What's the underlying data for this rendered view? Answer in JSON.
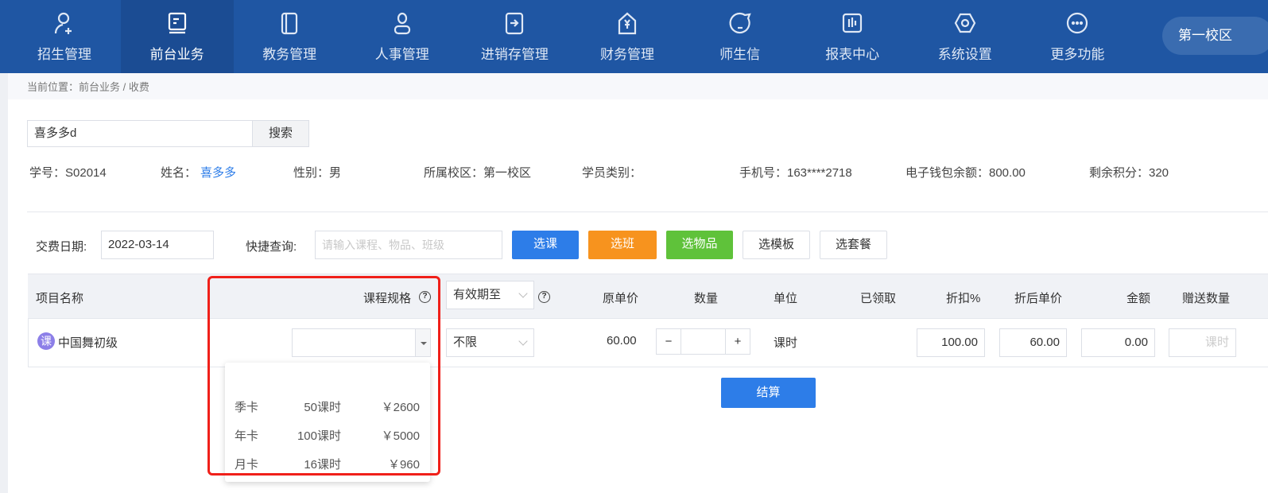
{
  "nav": {
    "items": [
      {
        "label": "招生管理",
        "icon": "user-add-icon"
      },
      {
        "label": "前台业务",
        "icon": "desk-icon",
        "active": true
      },
      {
        "label": "教务管理",
        "icon": "book-icon"
      },
      {
        "label": "人事管理",
        "icon": "person-icon"
      },
      {
        "label": "进销存管理",
        "icon": "inventory-arrow-icon"
      },
      {
        "label": "财务管理",
        "icon": "finance-yen-icon"
      },
      {
        "label": "师生信",
        "icon": "chat-icon"
      },
      {
        "label": "报表中心",
        "icon": "report-chart-icon"
      },
      {
        "label": "系统设置",
        "icon": "settings-hex-icon"
      },
      {
        "label": "更多功能",
        "icon": "more-dots-icon"
      }
    ],
    "campus": "第一校区"
  },
  "breadcrumb": "当前位置：前台业务 / 收费",
  "search": {
    "value": "喜多多d",
    "button": "搜索"
  },
  "student": {
    "id": "学号：S02014",
    "name_label": "姓名：",
    "name": "喜多多",
    "gender": "性别：男",
    "campus": "所属校区：第一校区",
    "type": "学员类别：",
    "phone": "手机号：163****2718",
    "wallet": "电子钱包余额：800.00",
    "points": "剩余积分：320"
  },
  "toolbar": {
    "date_label": "交费日期:",
    "date": "2022-03-14",
    "quick_label": "快捷查询:",
    "quick_placeholder": "请输入课程、物品、班级",
    "btn_course": "选课",
    "btn_class": "选班",
    "btn_goods": "选物品",
    "btn_template": "选模板",
    "btn_package": "选套餐"
  },
  "colors": {
    "nav": "#1f56a3",
    "blue": "#2d7de8",
    "orange": "#f7931e",
    "green": "#5fc23a",
    "highlight": "#f0201a"
  },
  "table": {
    "headers": {
      "name": "项目名称",
      "spec": "课程规格",
      "validity": "有效期至",
      "price": "原单价",
      "qty": "数量",
      "unit": "单位",
      "received": "已领取",
      "discount": "折扣%",
      "disc_price": "折后单价",
      "amount": "金额",
      "gift": "赠送数量"
    },
    "row": {
      "badge": "课",
      "name": "中国舞初级",
      "validity": "不限",
      "price": "60.00",
      "qty": "",
      "unit": "课时",
      "discount": "100.00",
      "disc_price": "60.00",
      "amount": "0.00",
      "gift_placeholder": "课时"
    }
  },
  "spec_options": [
    {
      "name": "季卡",
      "hours": "50课时",
      "price": "￥2600"
    },
    {
      "name": "年卡",
      "hours": "100课时",
      "price": "￥5000"
    },
    {
      "name": "月卡",
      "hours": "16课时",
      "price": "￥960"
    }
  ],
  "checkout": "结算"
}
